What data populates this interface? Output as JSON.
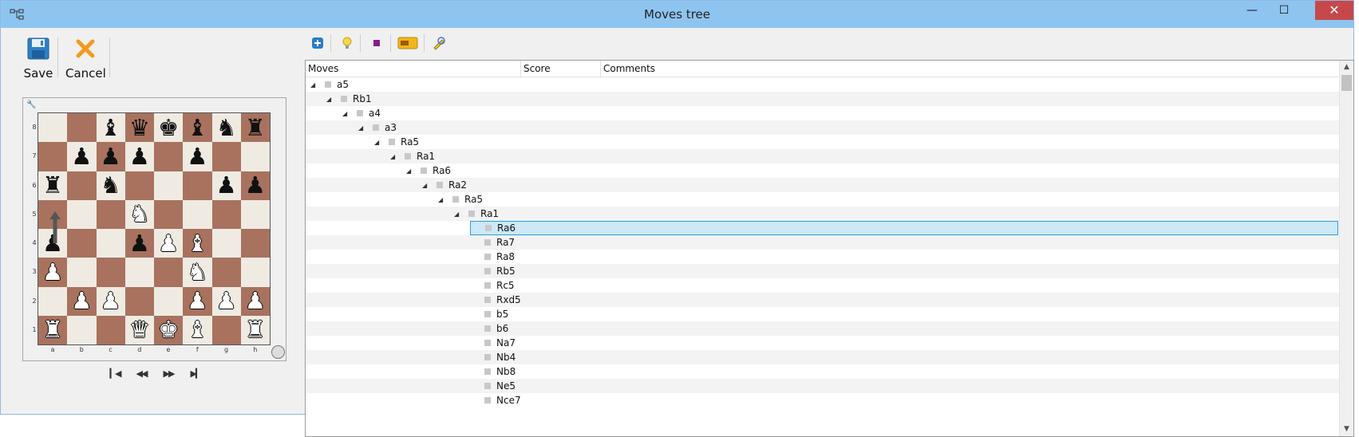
{
  "window": {
    "title": "Moves tree",
    "minimize_glyph": "—",
    "maximize_glyph": "☐",
    "close_glyph": "✕"
  },
  "actions": {
    "save_label": "Save",
    "cancel_label": "Cancel"
  },
  "toolbar": {
    "icons": [
      "add-icon",
      "lightbulb-icon",
      "square-icon",
      "card-icon",
      "edit-icon"
    ]
  },
  "board": {
    "ranks": [
      "8",
      "7",
      "6",
      "5",
      "4",
      "3",
      "2",
      "1"
    ],
    "files": [
      "a",
      "b",
      "c",
      "d",
      "e",
      "f",
      "g",
      "h"
    ],
    "position": [
      [
        "",
        "",
        "b",
        "q",
        "k",
        "b",
        "n",
        "r"
      ],
      [
        "",
        "p",
        "p",
        "p",
        "",
        "p",
        "",
        ""
      ],
      [
        "r",
        "",
        "n",
        "",
        "",
        "",
        "p",
        "p"
      ],
      [
        "",
        "",
        "",
        "N",
        "",
        "",
        "",
        ""
      ],
      [
        "p",
        "",
        "",
        "p",
        "P",
        "B",
        "",
        ""
      ],
      [
        "P",
        "",
        "",
        "",
        "",
        "N",
        "",
        ""
      ],
      [
        "",
        "P",
        "P",
        "",
        "",
        "P",
        "P",
        "P"
      ],
      [
        "R",
        "",
        "",
        "Q",
        "K",
        "B",
        "",
        "R"
      ]
    ],
    "light_color": "#efebe3",
    "dark_color": "#a8725e",
    "last_move_arrow": "a5-a6"
  },
  "tree": {
    "columns": [
      "Moves",
      "Score",
      "Comments"
    ],
    "rows": [
      {
        "move": "a5",
        "depth": 0,
        "expanded": true
      },
      {
        "move": "Rb1",
        "depth": 1,
        "expanded": true
      },
      {
        "move": "a4",
        "depth": 2,
        "expanded": true
      },
      {
        "move": "a3",
        "depth": 3,
        "expanded": true
      },
      {
        "move": "Ra5",
        "depth": 4,
        "expanded": true
      },
      {
        "move": "Ra1",
        "depth": 5,
        "expanded": true
      },
      {
        "move": "Ra6",
        "depth": 6,
        "expanded": true
      },
      {
        "move": "Ra2",
        "depth": 7,
        "expanded": true
      },
      {
        "move": "Ra5",
        "depth": 8,
        "expanded": true
      },
      {
        "move": "Ra1",
        "depth": 9,
        "expanded": true
      },
      {
        "move": "Ra6",
        "depth": 10,
        "expanded": false,
        "selected": true
      },
      {
        "move": "Ra7",
        "depth": 10,
        "expanded": false
      },
      {
        "move": "Ra8",
        "depth": 10,
        "expanded": false
      },
      {
        "move": "Rb5",
        "depth": 10,
        "expanded": false
      },
      {
        "move": "Rc5",
        "depth": 10,
        "expanded": false
      },
      {
        "move": "Rxd5",
        "depth": 10,
        "expanded": false
      },
      {
        "move": "b5",
        "depth": 10,
        "expanded": false
      },
      {
        "move": "b6",
        "depth": 10,
        "expanded": false
      },
      {
        "move": "Na7",
        "depth": 10,
        "expanded": false
      },
      {
        "move": "Nb4",
        "depth": 10,
        "expanded": false
      },
      {
        "move": "Nb8",
        "depth": 10,
        "expanded": false
      },
      {
        "move": "Ne5",
        "depth": 10,
        "expanded": false
      },
      {
        "move": "Nce7",
        "depth": 10,
        "expanded": false
      }
    ]
  }
}
